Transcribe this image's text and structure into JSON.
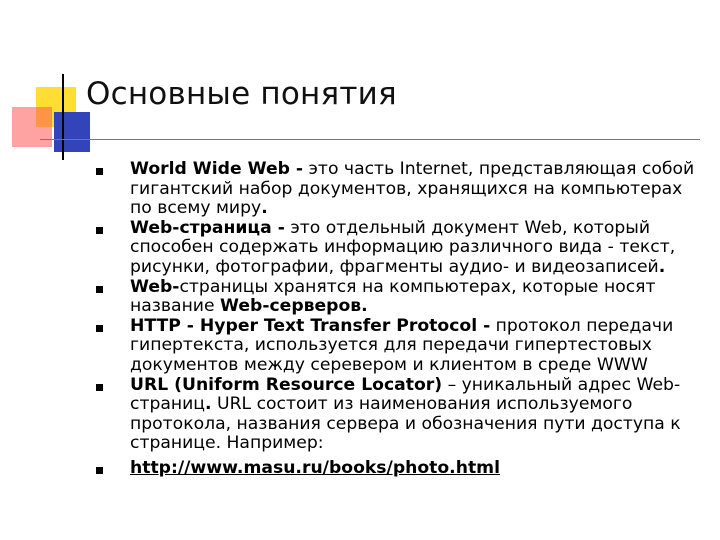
{
  "slide": {
    "title": "Основные понятия",
    "items": [
      {
        "term": "World Wide Web -",
        "text1": " это часть Internet, представляющая собой гигантский набор документов, хранящихся на компьютерах по всему миру",
        "end": "."
      },
      {
        "term": "Web-страница -",
        "text1": " это отдельный документ Web, который способен содержать информацию различного вида - текст, рисунки, фотографии, фрагменты аудио- и видеозаписей",
        "end": "."
      },
      {
        "term": "Web-",
        "text1": "страницы хранятся на компьютерах, которые носят название ",
        "term2": "Web-серверов."
      },
      {
        "term": "HTTP - Hyper Text Transfer Protocol -",
        "text1": " протокол передачи гипертекста, используется для передачи гипертестовых документов между серевером и клиентом в среде WWW"
      },
      {
        "term": "URL (Uniform Resource Locator)",
        "text1": " – уникальный адрес Web-страниц",
        "term2": ".",
        "text2": " URL состоит из наименования используемого протокола, названия сервера и обозначения пути доступа к странице. Например:"
      },
      {
        "link": "http://www.masu.ru/books/photo.html"
      }
    ]
  }
}
